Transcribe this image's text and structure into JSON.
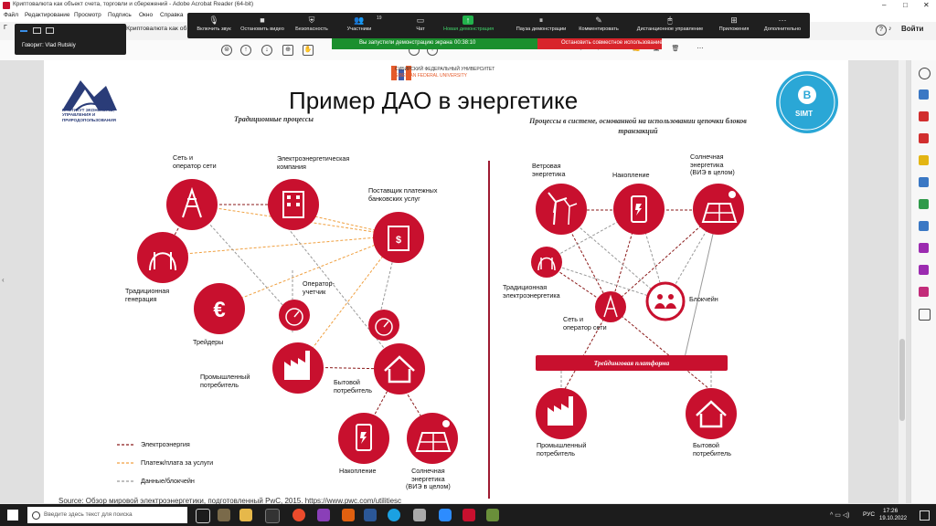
{
  "window": {
    "title": "Криптовалюта как объект счета, торговли и сбережений - Adobe Acrobat Reader (64-bit)"
  },
  "menu": [
    "Файл",
    "Редактирование",
    "Просмотр",
    "Подпись",
    "Окно",
    "Справка"
  ],
  "tab": {
    "label": "Криптовалюта как об"
  },
  "signin": "Войти",
  "zoom_toolbar": {
    "items": [
      "Включить звук",
      "Остановить видео",
      "Безопасность",
      "Участники",
      "Чат",
      "Новая демонстрация",
      "Пауза демонстрации",
      "Комментировать",
      "Дистанционное управление",
      "Приложения",
      "Дополнительно"
    ],
    "participants_count": "19"
  },
  "zoom_view": {
    "speaking": "Говорит: Vlad Rutskiy"
  },
  "share_bar": {
    "message": "Вы запустили демонстрацию экрана",
    "timer": "00:38:10",
    "stop": "Остановить совместное использование"
  },
  "slide": {
    "university": "СИБИРСКИЙ ФЕДЕРАЛЬНЫЙ УНИВЕРСИТЕТ",
    "university_en": "SIBERIAN FEDERAL UNIVERSITY",
    "institute": "ИНСТИТУТ ЭКОНОМИКИ, УПРАВЛЕНИЯ И ПРИРОДОПОЛЬЗОВАНИЯ",
    "simt": "SIMT",
    "title": "Пример ДАО в энергетике",
    "left_heading": "Традиционные процессы",
    "right_heading": "Процессы в системе, основанной на использовании цепочки блоков транзакций",
    "left_nodes": {
      "grid": "Сеть и\nоператор сети",
      "company": "Электроэнергетическая\nкомпания",
      "payment": "Поставщик платежных\nбанковских услуг",
      "generation": "Традиционная\nгенерация",
      "operator": "Оператор-\nучетчик",
      "traders": "Трейдеры",
      "industrial": "Промышленный\nпотребитель",
      "household": "Бытовой\nпотребитель",
      "storage": "Накопление",
      "solar": "Солнечная\nэнергетика\n(ВИЭ в целом)"
    },
    "right_nodes": {
      "wind": "Ветровая\nэнергетика",
      "storage": "Накопление",
      "solar": "Солнечная\nэнергетика\n(ВИЭ в целом)",
      "trad": "Традиционная\nэлектроэнергетика",
      "blockchain": "Блокчейн",
      "grid": "Сеть и\nоператор сети",
      "platform": "Трейдинговая платформа",
      "industrial": "Промышленный\nпотребитель",
      "household": "Бытовой\nпотребитель"
    },
    "legend": [
      "Электроэнергия",
      "Платеж/плата за услуги",
      "Данные/блокчейн"
    ],
    "source": "Source: Обзор мировой электроэнергетики, подготовленный PwC, 2015. https://www.pwc.com/utilitiesc"
  },
  "taskbar": {
    "search_placeholder": "Введите здесь текст для поиска",
    "lang": "РУС",
    "time": "17:26",
    "date": "19.10.2022"
  },
  "colors": {
    "accent": "#c8102e",
    "zoom_green": "#1b8f2e",
    "legend_power": "#8b1a1a",
    "legend_payment": "#f0a040",
    "legend_data": "#999999"
  }
}
